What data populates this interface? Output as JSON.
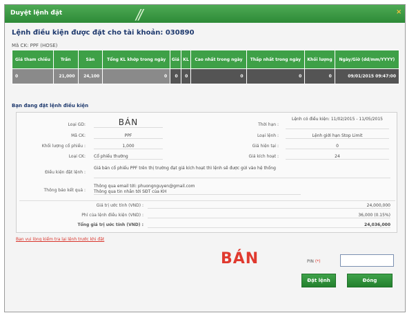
{
  "window": {
    "title": "Duyệt lệnh đặt",
    "close_glyph": "×"
  },
  "header": {
    "heading": "Lệnh điều kiện được đặt cho tài khoản: 030890",
    "stock_label": "Mã CK: PPF (HOSE)"
  },
  "price_table": {
    "columns": [
      "Giá tham chiếu",
      "Trần",
      "Sàn",
      "Tổng KL khớp trong ngày",
      "Giá",
      "KL",
      "Cao nhất trong ngày",
      "Thấp nhất trong ngày",
      "Khối lượng",
      "Ngày/Giờ (dd/mm/YYYY)"
    ],
    "row": [
      "0",
      "21,000",
      "24,100",
      "0",
      "0",
      "0",
      "0",
      "0",
      "0",
      "09/01/2015 09:47:00"
    ]
  },
  "section_label": "Bạn đang đặt lệnh điều kiện",
  "form": {
    "side_label": "Loại GD:",
    "side_value": "BÁN",
    "symbol_label": "Mã CK:",
    "symbol_value": "PPF",
    "qty_label": "Khối lượng cổ phiếu :",
    "qty_value": "1,000",
    "type_label": "Loại CK:",
    "type_value": "Cổ phiếu thường",
    "validity_label": "Thời hạn :",
    "validity_value": "Lệnh có điều kiện: 11/02/2015 - 11/05/2015",
    "order_type_label": "Loại lệnh :",
    "order_type_value": "Lệnh giới hạn Stop Limit",
    "trigger_label": "Giá hiện tại :",
    "trigger_value": "0",
    "limit_label": "Giá kích hoạt :",
    "limit_value": "24",
    "cond_label": "Điều kiện đặt lệnh :",
    "cond_value": "Giá bán cổ phiếu PPF trên thị trường đạt giá kích hoạt thì lệnh sẽ được gửi vào hệ thống",
    "notify_label": "Thông báo kết quả :",
    "notify_value_1": "Thông qua email tới: phuongnguyen@gmail.com",
    "notify_value_2": "Thông qua tin nhắn tới SĐT của KH",
    "total_label": "Giá trị ước tính (VND) :",
    "total_value": "24,000,000",
    "fee_label": "Phí của lệnh điều kiện (VND) :",
    "fee_value": "36,000 (0.15%)",
    "grand_label": "Tổng giá trị ước tính (VND) :",
    "grand_value": "24,036,000"
  },
  "note": {
    "link": "Bạn vui lòng kiểm tra lại lệnh trước khi đặt",
    "suffix": ""
  },
  "confirm": {
    "side_big": "BÁN",
    "pin_label": "PIN",
    "pin_required": "(*)",
    "pin_value": ""
  },
  "buttons": {
    "submit": "Đặt lệnh",
    "close": "Đóng"
  },
  "colors": {
    "header_green": "#3ea047",
    "accent_red": "#e03a2f",
    "row_grey": "#8a8a8a"
  }
}
